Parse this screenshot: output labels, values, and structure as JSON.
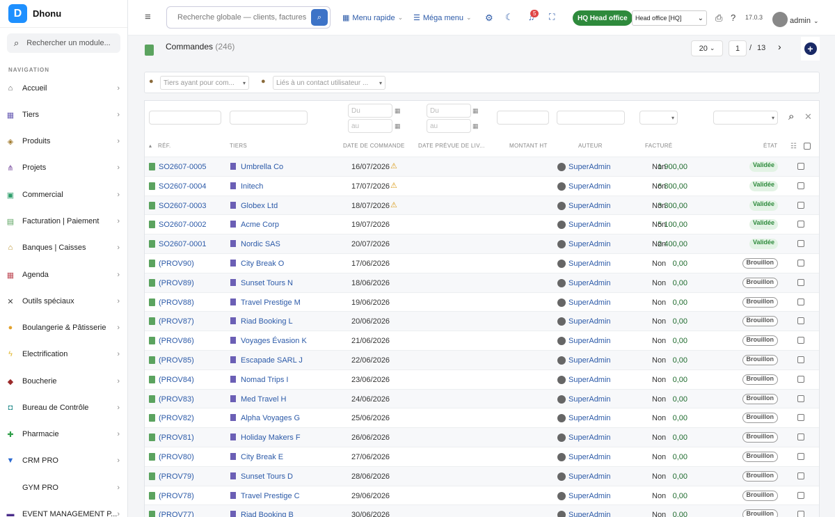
{
  "app": {
    "name": "Dhonu",
    "logo_letter": "D"
  },
  "sidebar": {
    "search_placeholder": "Rechercher un module...",
    "section_title": "NAVIGATION",
    "items": [
      {
        "label": "Accueil",
        "icon": "home-icon",
        "glyph": "⌂",
        "color": "#555"
      },
      {
        "label": "Tiers",
        "icon": "building-icon",
        "glyph": "▦",
        "color": "#6b5fb5"
      },
      {
        "label": "Produits",
        "icon": "box-icon",
        "glyph": "◈",
        "color": "#a07a2c"
      },
      {
        "label": "Projets",
        "icon": "sitemap-icon",
        "glyph": "⋔",
        "color": "#7b4fa0"
      },
      {
        "label": "Commercial",
        "icon": "briefcase-icon",
        "glyph": "▣",
        "color": "#2e9e6b"
      },
      {
        "label": "Facturation | Paiement",
        "icon": "invoice-icon",
        "glyph": "▤",
        "color": "#5ba35f"
      },
      {
        "label": "Banques | Caisses",
        "icon": "bank-icon",
        "glyph": "⌂",
        "color": "#b58a1e"
      },
      {
        "label": "Agenda",
        "icon": "calendar-icon",
        "glyph": "▦",
        "color": "#c0505b"
      },
      {
        "label": "Outils spéciaux",
        "icon": "tools-icon",
        "glyph": "✕",
        "color": "#444"
      },
      {
        "label": "Boulangerie & Pâtisserie",
        "icon": "bread-icon",
        "glyph": "●",
        "color": "#e2a22e"
      },
      {
        "label": "Electrification",
        "icon": "bolt-icon",
        "glyph": "ϟ",
        "color": "#e2b72e"
      },
      {
        "label": "Boucherie",
        "icon": "meat-icon",
        "glyph": "◆",
        "color": "#9b2a2a"
      },
      {
        "label": "Bureau de Contrôle",
        "icon": "control-icon",
        "glyph": "◘",
        "color": "#2b8f8f"
      },
      {
        "label": "Pharmacie",
        "icon": "plus-cross-icon",
        "glyph": "✚",
        "color": "#2e9e48"
      },
      {
        "label": "CRM PRO",
        "icon": "funnel-icon",
        "glyph": "▼",
        "color": "#2c6ad1"
      },
      {
        "label": "GYM PRO",
        "icon": "gym-icon",
        "glyph": "",
        "color": "#444"
      },
      {
        "label": "EVENT MANAGEMENT P...",
        "icon": "event-icon",
        "glyph": "▬",
        "color": "#4a2c8a"
      }
    ]
  },
  "topbar": {
    "search_placeholder": "Recherche globale — clients, factures, p",
    "menu_rapide": "Menu rapide",
    "mega_menu": "Méga menu",
    "notif_count": "5",
    "hq_badge": "HQ Head office",
    "entity_select": "Head office [HQ]",
    "version": "17.0.3",
    "user": "admin"
  },
  "page": {
    "title": "Commandes",
    "count": "(246)",
    "per_page": "20",
    "page": "1",
    "page_sep": "/",
    "total_pages": "13"
  },
  "filters": {
    "tiers_placeholder": "Tiers ayant pour com...",
    "contact_placeholder": "Liés à un contact utilisateur ...",
    "date_from": "Du",
    "date_to": "au"
  },
  "columns": {
    "ref": "RÉF.",
    "tiers": "TIERS",
    "date": "DATE DE COMMANDE",
    "date_prev": "DATE PRÉVUE DE LIV...",
    "montant": "MONTANT HT",
    "auteur": "AUTEUR",
    "facture": "FACTURÉ",
    "etat": "ÉTAT"
  },
  "rows": [
    {
      "ref": "SO2607-0005",
      "tiers": "Umbrella Co",
      "date": "16/07/2026",
      "warn": true,
      "amount": "1 900,00",
      "author": "SuperAdmin",
      "billed": "Non",
      "status": "Validée",
      "status_type": "ok"
    },
    {
      "ref": "SO2607-0004",
      "tiers": "Initech",
      "date": "17/07/2026",
      "warn": true,
      "amount": "6 800,00",
      "author": "SuperAdmin",
      "billed": "Non",
      "status": "Validée",
      "status_type": "ok"
    },
    {
      "ref": "SO2607-0003",
      "tiers": "Globex Ltd",
      "date": "18/07/2026",
      "warn": true,
      "amount": "3 300,00",
      "author": "SuperAdmin",
      "billed": "Non",
      "status": "Validée",
      "status_type": "ok"
    },
    {
      "ref": "SO2607-0002",
      "tiers": "Acme Corp",
      "date": "19/07/2026",
      "warn": false,
      "amount": "5 100,00",
      "author": "SuperAdmin",
      "billed": "Non",
      "status": "Validée",
      "status_type": "ok"
    },
    {
      "ref": "SO2607-0001",
      "tiers": "Nordic SAS",
      "date": "20/07/2026",
      "warn": false,
      "amount": "2 400,00",
      "author": "SuperAdmin",
      "billed": "Non",
      "status": "Validée",
      "status_type": "ok"
    },
    {
      "ref": "(PROV90)",
      "tiers": "City Break O",
      "date": "17/06/2026",
      "warn": false,
      "amount": "0,00",
      "author": "SuperAdmin",
      "billed": "Non",
      "status": "Brouillon",
      "status_type": "draft"
    },
    {
      "ref": "(PROV89)",
      "tiers": "Sunset Tours N",
      "date": "18/06/2026",
      "warn": false,
      "amount": "0,00",
      "author": "SuperAdmin",
      "billed": "Non",
      "status": "Brouillon",
      "status_type": "draft"
    },
    {
      "ref": "(PROV88)",
      "tiers": "Travel Prestige M",
      "date": "19/06/2026",
      "warn": false,
      "amount": "0,00",
      "author": "SuperAdmin",
      "billed": "Non",
      "status": "Brouillon",
      "status_type": "draft"
    },
    {
      "ref": "(PROV87)",
      "tiers": "Riad Booking L",
      "date": "20/06/2026",
      "warn": false,
      "amount": "0,00",
      "author": "SuperAdmin",
      "billed": "Non",
      "status": "Brouillon",
      "status_type": "draft"
    },
    {
      "ref": "(PROV86)",
      "tiers": "Voyages Évasion K",
      "date": "21/06/2026",
      "warn": false,
      "amount": "0,00",
      "author": "SuperAdmin",
      "billed": "Non",
      "status": "Brouillon",
      "status_type": "draft"
    },
    {
      "ref": "(PROV85)",
      "tiers": "Escapade SARL J",
      "date": "22/06/2026",
      "warn": false,
      "amount": "0,00",
      "author": "SuperAdmin",
      "billed": "Non",
      "status": "Brouillon",
      "status_type": "draft"
    },
    {
      "ref": "(PROV84)",
      "tiers": "Nomad Trips I",
      "date": "23/06/2026",
      "warn": false,
      "amount": "0,00",
      "author": "SuperAdmin",
      "billed": "Non",
      "status": "Brouillon",
      "status_type": "draft"
    },
    {
      "ref": "(PROV83)",
      "tiers": "Med Travel H",
      "date": "24/06/2026",
      "warn": false,
      "amount": "0,00",
      "author": "SuperAdmin",
      "billed": "Non",
      "status": "Brouillon",
      "status_type": "draft"
    },
    {
      "ref": "(PROV82)",
      "tiers": "Alpha Voyages G",
      "date": "25/06/2026",
      "warn": false,
      "amount": "0,00",
      "author": "SuperAdmin",
      "billed": "Non",
      "status": "Brouillon",
      "status_type": "draft"
    },
    {
      "ref": "(PROV81)",
      "tiers": "Holiday Makers F",
      "date": "26/06/2026",
      "warn": false,
      "amount": "0,00",
      "author": "SuperAdmin",
      "billed": "Non",
      "status": "Brouillon",
      "status_type": "draft"
    },
    {
      "ref": "(PROV80)",
      "tiers": "City Break E",
      "date": "27/06/2026",
      "warn": false,
      "amount": "0,00",
      "author": "SuperAdmin",
      "billed": "Non",
      "status": "Brouillon",
      "status_type": "draft"
    },
    {
      "ref": "(PROV79)",
      "tiers": "Sunset Tours D",
      "date": "28/06/2026",
      "warn": false,
      "amount": "0,00",
      "author": "SuperAdmin",
      "billed": "Non",
      "status": "Brouillon",
      "status_type": "draft"
    },
    {
      "ref": "(PROV78)",
      "tiers": "Travel Prestige C",
      "date": "29/06/2026",
      "warn": false,
      "amount": "0,00",
      "author": "SuperAdmin",
      "billed": "Non",
      "status": "Brouillon",
      "status_type": "draft"
    },
    {
      "ref": "(PROV77)",
      "tiers": "Riad Booking B",
      "date": "30/06/2026",
      "warn": false,
      "amount": "0,00",
      "author": "SuperAdmin",
      "billed": "Non",
      "status": "Brouillon",
      "status_type": "draft"
    }
  ]
}
